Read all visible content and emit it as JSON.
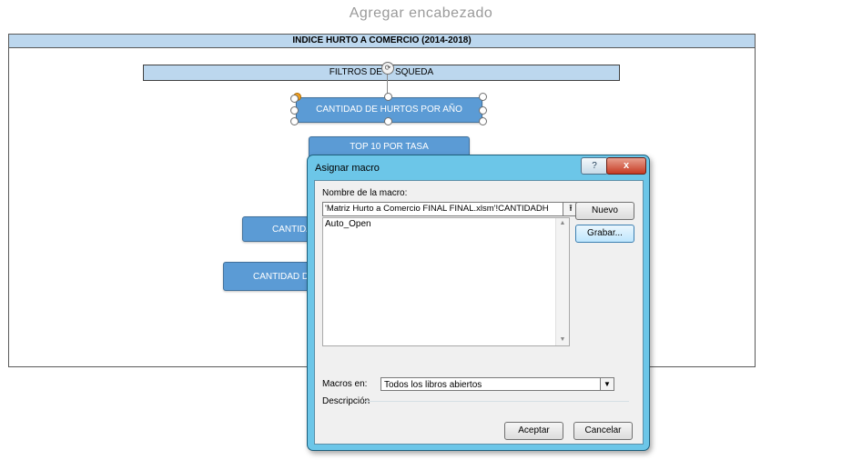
{
  "page": {
    "header_hint": "Agregar encabezado",
    "sheet_title": "INDICE HURTO A COMERCIO (2014-2018)",
    "filter_label": "FILTROS DE BÚSQUEDA",
    "filter_label_visible": "FILTROS DE",
    "filter_label_suffix": "SQUEDA"
  },
  "shapes": {
    "btn1": "CANTIDAD DE HURTOS POR AÑO",
    "btn2": "TOP 10 POR TASA",
    "btn4": "CANTIDA",
    "btn5": "CANTIDAD D"
  },
  "dialog": {
    "title": "Asignar macro",
    "help_label": "?",
    "close_label": "x",
    "name_label": "Nombre de la macro:",
    "name_value": "'Matriz Hurto a Comercio FINAL FINAL.xlsm'!CANTIDADH",
    "upload_icon": "upload-arrow-icon",
    "macros": [
      "Auto_Open"
    ],
    "new_button": "Nuevo",
    "record_button": "Grabar...",
    "macros_in_label": "Macros en:",
    "macros_in_value": "Todos los libros abiertos",
    "description_label": "Descripción",
    "ok_button": "Aceptar",
    "cancel_button": "Cancelar"
  },
  "colors": {
    "accent_blue": "#5b9bd5",
    "header_fill": "#bcd7ee",
    "dialog_frame": "#6cc6e8"
  }
}
